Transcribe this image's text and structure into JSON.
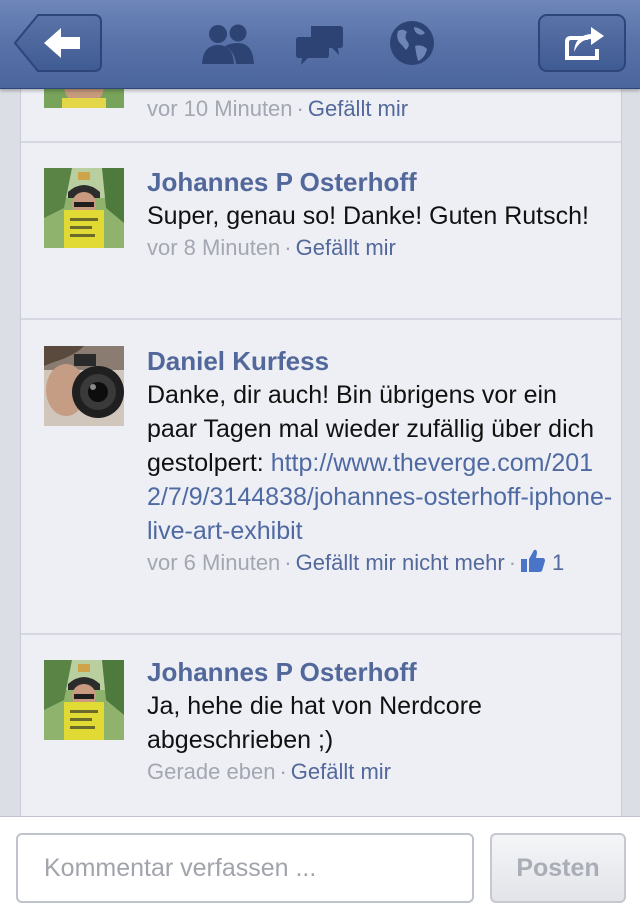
{
  "nav": {
    "icons": [
      "back-arrow-icon",
      "friends-icon",
      "messages-icon",
      "globe-icon",
      "share-icon"
    ]
  },
  "comments": [
    {
      "time": "vor 10 Minuten",
      "like_label": "Gefällt mir"
    },
    {
      "author": "Johannes P Osterhoff",
      "text": "Super, genau so! Danke! Guten Rutsch!",
      "time": "vor 8 Minuten",
      "like_label": "Gefällt mir"
    },
    {
      "author": "Daniel Kurfess",
      "text": "Danke, dir auch! Bin übrigens vor ein paar Tagen mal wieder zufällig über dich gestolpert: ",
      "link": "http://www.theverge.com/2012/7/9/3144838/johannes-osterhoff-iphone-live-art-exhibit",
      "time": "vor 6 Minuten",
      "like_label": "Gefällt mir nicht mehr",
      "like_count": "1"
    },
    {
      "author": "Johannes P Osterhoff",
      "text": "Ja, hehe die hat von Nerdcore abgeschrieben ;)",
      "time": "Gerade eben",
      "like_label": "Gefällt mir"
    }
  ],
  "composer": {
    "placeholder": "Kommentar verfassen ...",
    "post_label": "Posten"
  },
  "colors": {
    "nav_bar": "#5a74aa",
    "author_name": "#52689a",
    "feed_background": "#edeff5"
  }
}
